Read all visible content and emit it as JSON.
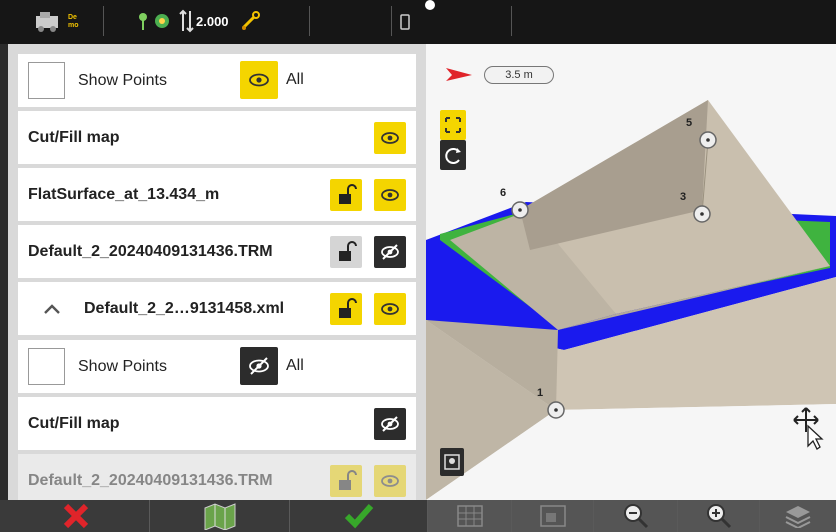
{
  "status": {
    "demo_label_top": "De",
    "demo_label_bottom": "mo",
    "gnss_value": "2.000",
    "icons": [
      "machine-icon",
      "gnss-icon",
      "sensor-height-icon",
      "tools-icon",
      "device-icon"
    ]
  },
  "layers": [
    {
      "type": "show-points",
      "label": "Show Points",
      "all_label": "All",
      "visible": true
    },
    {
      "type": "layer",
      "label": "Cut/Fill map",
      "visible": true
    },
    {
      "type": "layer",
      "label": "FlatSurface_at_13.434_m",
      "locked": false,
      "visible": true
    },
    {
      "type": "layer",
      "label": "Default_2_20240409131436.TRM",
      "locked": false,
      "visible": false
    },
    {
      "type": "group",
      "label": "Default_2_2…9131458.xml",
      "expanded": true,
      "locked": false,
      "visible": true
    },
    {
      "type": "show-points",
      "label": "Show Points",
      "all_label": "All",
      "visible": false
    },
    {
      "type": "layer",
      "label": "Cut/Fill map",
      "visible": false
    },
    {
      "type": "layer",
      "label": "Default_2_20240409131436.TRM",
      "locked": false,
      "visible": true
    }
  ],
  "map": {
    "scale_label": "3.5 m",
    "point_labels": [
      "1",
      "3",
      "5",
      "6"
    ],
    "colors": {
      "blue": "#1a1aee",
      "green": "#3fb33f",
      "surface": "#c9bfae"
    }
  },
  "bottom": {
    "left_buttons": [
      "cancel-icon",
      "map-icon",
      "confirm-icon"
    ],
    "right_buttons": [
      "grid-icon",
      "layers-view-icon",
      "zoom-out-icon",
      "zoom-in-icon",
      "stack-icon"
    ]
  },
  "colors": {
    "accent_yellow": "#f4d500",
    "dark": "#2c2c2c",
    "cancel_red": "#e0242a",
    "confirm_green": "#37a82a"
  }
}
